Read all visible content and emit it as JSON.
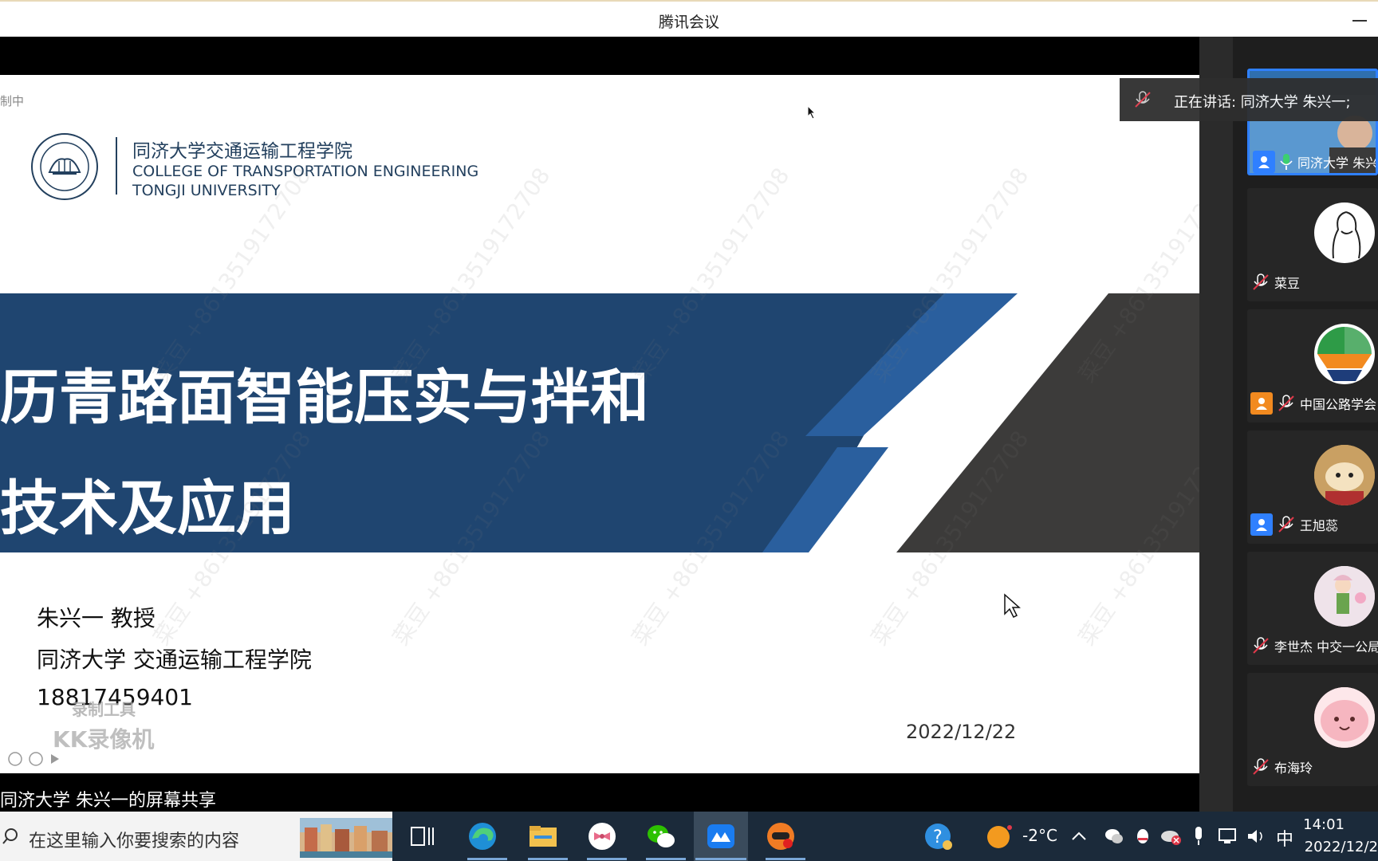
{
  "window": {
    "title": "腾讯会议"
  },
  "slide": {
    "recording_label": "制中",
    "logo": {
      "cn": "同济大学交通运输工程学院",
      "en_line1": "COLLEGE OF TRANSPORTATION ENGINEERING",
      "en_line2": "TONGJI UNIVERSITY"
    },
    "title_line1": "历青路面智能压实与拌和",
    "title_line2": "技术及应用",
    "author": "朱兴一 教授",
    "affiliation": "同济大学 交通运输工程学院",
    "phone": "18817459401",
    "date": "2022/12/22",
    "watermark_tool": "录制工具",
    "watermark_kk": "KK录像机",
    "watermark_text": "菜豆 +8613519172708"
  },
  "share_label": "同济大学 朱兴一的屏幕共享",
  "speaking_banner": "正在讲话: 同济大学 朱兴一;",
  "participants": [
    {
      "name": "同济大学 朱兴",
      "mic": "on",
      "active": true
    },
    {
      "name": "菜豆",
      "mic": "off"
    },
    {
      "name": "中国公路学会",
      "mic": "off"
    },
    {
      "name": "王旭蕊",
      "mic": "off"
    },
    {
      "name": "李世杰 中交一公局",
      "mic": "off"
    },
    {
      "name": "布海玲",
      "mic": "off"
    }
  ],
  "taskbar": {
    "search_placeholder": "在这里输入你要搜索的内容",
    "weather": "-2°C",
    "ime": "中",
    "time": "14:01",
    "date": "2022/12/2"
  },
  "colors": {
    "slide_blue": "#1f4570",
    "slide_dark": "#3c3c3c",
    "panel_bg": "#1e1e1e",
    "taskbar_bg": "#1b2a3a"
  }
}
